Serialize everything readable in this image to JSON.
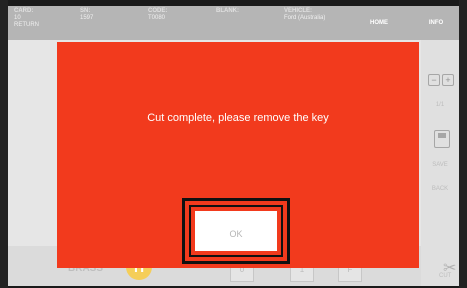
{
  "header": {
    "card_label": "CARD:",
    "card_value": "10",
    "card_sub": "RETURN",
    "sn_label": "SN:",
    "sn_value": "1597",
    "code_label": "CODE:",
    "code_value": "T0080",
    "blank_label": "BLANK:",
    "vehicle_label": "VEHICLE:",
    "vehicle_value": "Ford (Australia)",
    "home_label": "HOME",
    "info_label": "INFO"
  },
  "right_panel": {
    "zoom_label": "1/1",
    "save_label": "SAVE",
    "back_label": "BACK",
    "cut_label": "CUT"
  },
  "bottom": {
    "material_label": "BRASS",
    "material_icon": "H",
    "box1": "0",
    "box2": "1",
    "box3": "F"
  },
  "modal": {
    "message": "Cut complete, please remove the key",
    "ok_label": "OK",
    "accent": "#f23a1d"
  }
}
